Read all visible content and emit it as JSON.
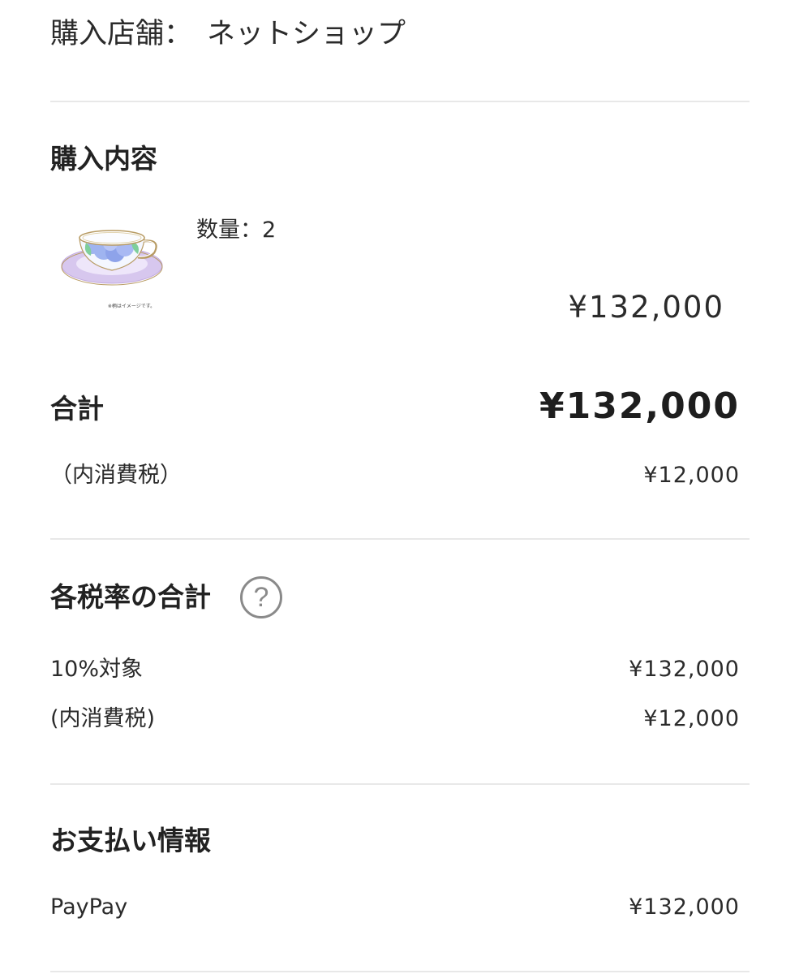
{
  "store": {
    "label": "購入店舗",
    "separator": "：",
    "name": "ネットショップ"
  },
  "purchase": {
    "title": "購入内容",
    "items": [
      {
        "image_caption": "※柄はイメージです。",
        "quantity_label": "数量：2",
        "price": "¥132,000"
      }
    ]
  },
  "summary": {
    "total_label": "合計",
    "total_value": "¥132,000",
    "tax_label": "（内消費税）",
    "tax_value": "¥12,000"
  },
  "tax_rates": {
    "title": "各税率の合計",
    "help_icon": "question-circle-icon",
    "help_glyph": "?",
    "rows": [
      {
        "label": "10%対象",
        "value": "¥132,000"
      },
      {
        "label": "(内消費税)",
        "value": "¥12,000"
      }
    ]
  },
  "payment": {
    "title": "お支払い情報",
    "method": "PayPay",
    "amount": "¥132,000"
  },
  "colors": {
    "divider": "#e8e8e8",
    "text": "#222222",
    "help_icon": "#8a8a8a",
    "saucer_accent": "#c9b3e6",
    "flower_blue": "#8fa6ea"
  }
}
